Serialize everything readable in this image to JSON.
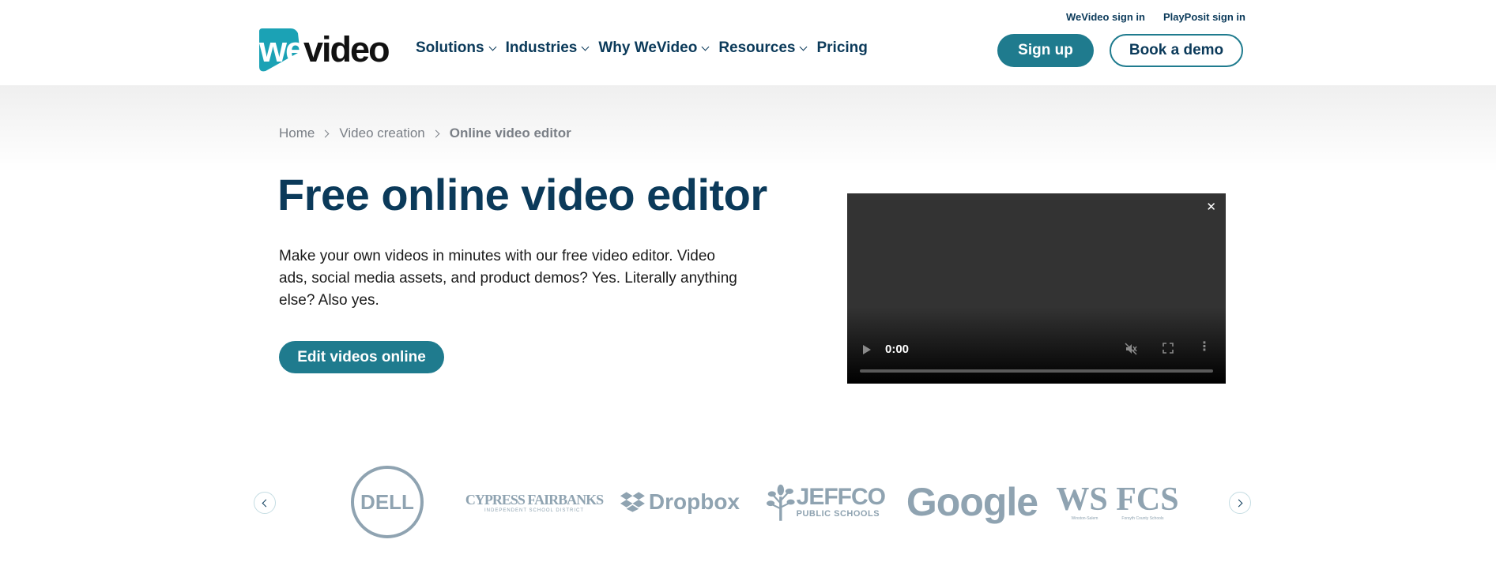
{
  "header": {
    "logo_text": "wevideo",
    "nav": [
      {
        "label": "Solutions",
        "has_dropdown": true
      },
      {
        "label": "Industries",
        "has_dropdown": true
      },
      {
        "label": "Why WeVideo",
        "has_dropdown": true
      },
      {
        "label": "Resources",
        "has_dropdown": true
      },
      {
        "label": "Pricing",
        "has_dropdown": false
      }
    ],
    "top_links": [
      "WeVideo sign in",
      "PlayPosit sign in"
    ],
    "signup_label": "Sign up",
    "demo_label": "Book a demo",
    "accent_color": "#1f7b8e",
    "text_color": "#0b3a5a"
  },
  "breadcrumb": [
    "Home",
    "Video creation",
    "Online video editor"
  ],
  "hero": {
    "title": "Free online video editor",
    "description": "Make your own videos in minutes with our free video editor. Video ads, social media assets, and product demos? Yes. Literally anything else? Also yes.",
    "cta_label": "Edit videos online"
  },
  "video": {
    "time": "0:00",
    "close_glyph": "✕",
    "progress": 0
  },
  "logos": {
    "items": [
      "DELL",
      "CYPRESS FAIRBANKS",
      "Dropbox",
      "JEFFCO",
      "Google",
      "WS FCS"
    ],
    "cypress_sub": "INDEPENDENT SCHOOL DISTRICT",
    "jeffco_sub": "PUBLIC SCHOOLS",
    "wsfcs_sub_left": "Winston-Salem",
    "wsfcs_sub_right": "Forsyth County Schools"
  }
}
